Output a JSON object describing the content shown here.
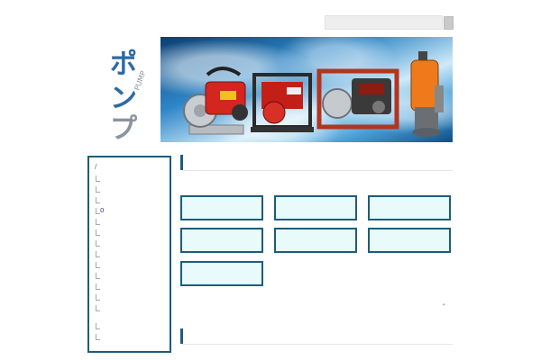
{
  "search": {
    "placeholder": "",
    "value": ""
  },
  "banner": {
    "logo_text": "ポンプ",
    "logo_sub": "PUMP",
    "colors": {
      "logo_blue": "#2d6aa4",
      "logo_gray": "#8a949c"
    }
  },
  "sidebar": {
    "slash": "/",
    "marker": "0"
  },
  "main": {
    "tiles_count_shown": 7,
    "marker": "\""
  },
  "colors": {
    "accent": "#1b5d7c",
    "tile_bg": "#e8fafa"
  }
}
